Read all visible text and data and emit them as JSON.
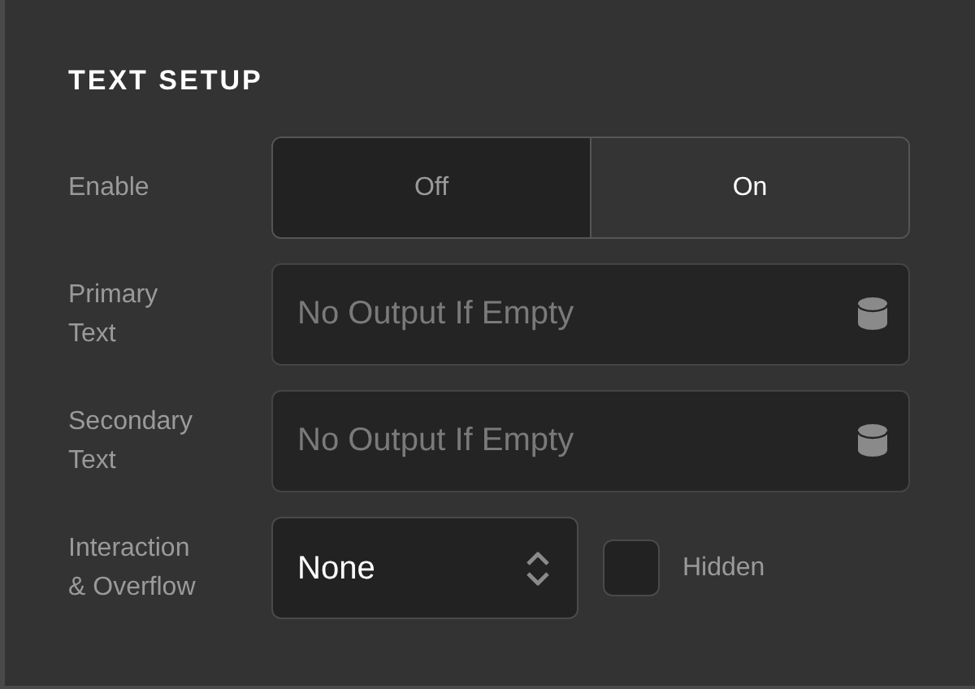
{
  "section": {
    "title": "TEXT SETUP"
  },
  "rows": [
    {
      "kind": "toggle",
      "label": "Enable",
      "options": [
        {
          "label": "Off",
          "selected": false
        },
        {
          "label": "On",
          "selected": true
        }
      ]
    },
    {
      "kind": "field",
      "label": "Primary Text",
      "placeholder": "No Output If Empty"
    },
    {
      "kind": "field",
      "label": "Secondary Text",
      "placeholder": "No Output If Empty"
    },
    {
      "kind": "select",
      "label": "Interaction & Overflow",
      "value": "None",
      "checkbox": {
        "label": "Hidden",
        "checked": false
      }
    }
  ]
}
